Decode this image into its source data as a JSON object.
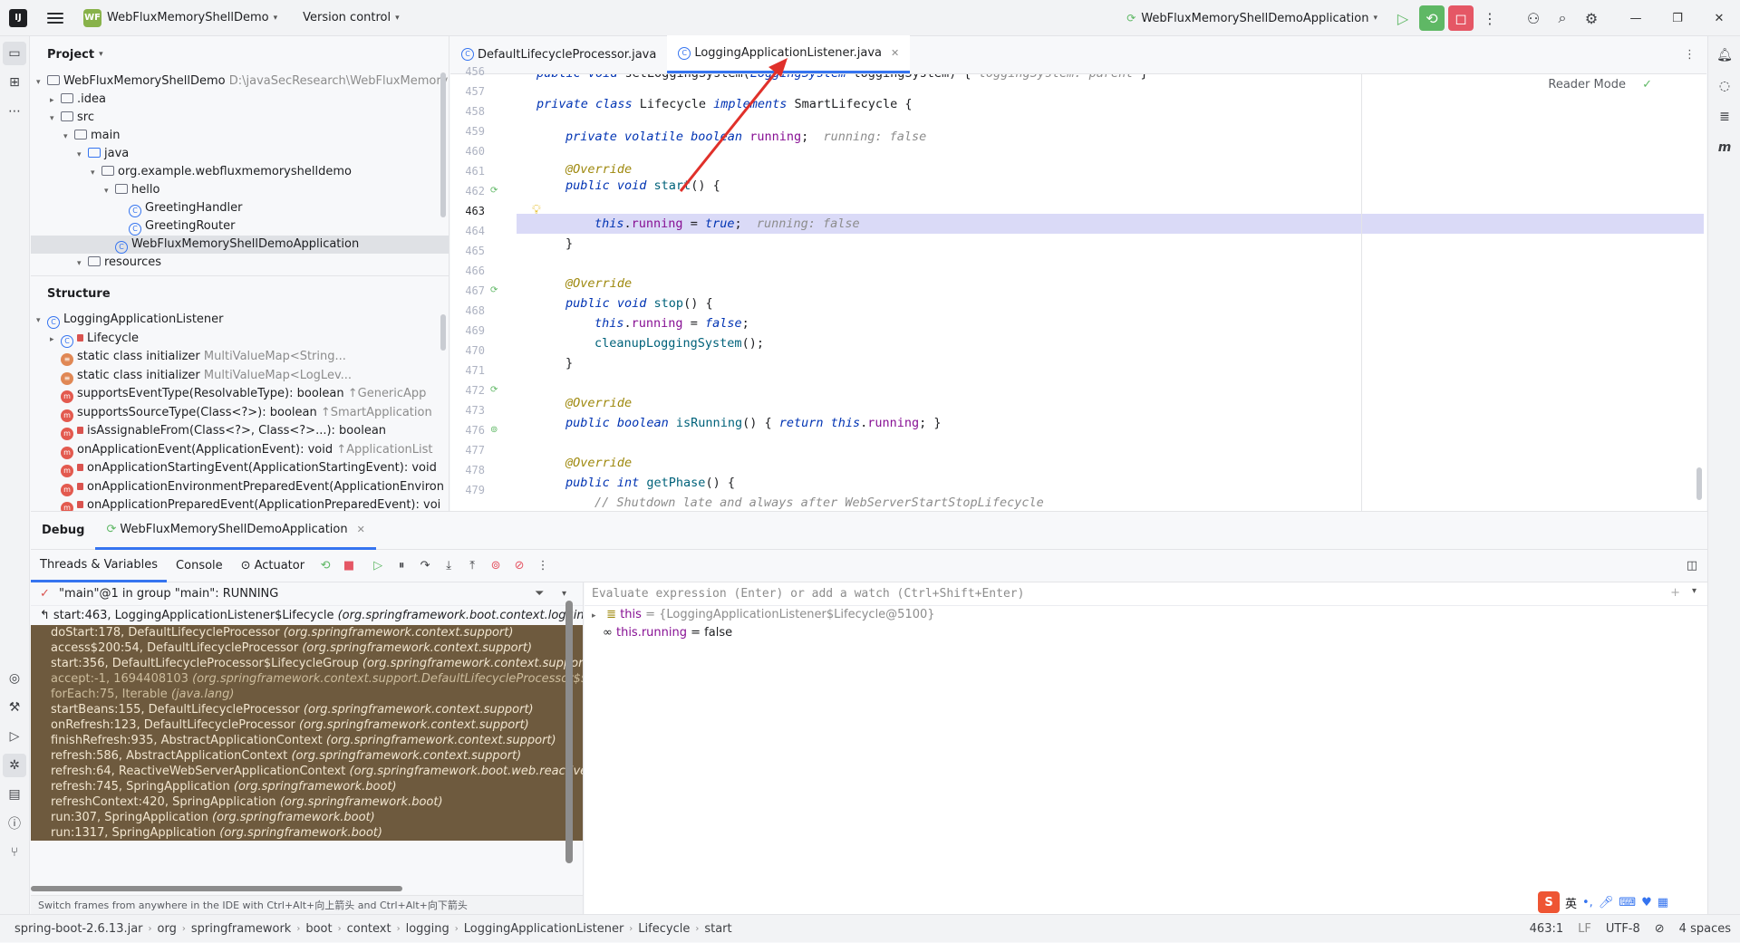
{
  "titlebar": {
    "project_badge": "WF",
    "project_name": "WebFluxMemoryShellDemo",
    "vcs_label": "Version control",
    "run_config": "WebFluxMemoryShellDemoApplication"
  },
  "project_panel": {
    "title": "Project",
    "tree": [
      {
        "indent": 0,
        "twisty": "▾",
        "icon": "folder",
        "label": "WebFluxMemoryShellDemo",
        "hint": "D:\\javaSecResearch\\WebFluxMemory"
      },
      {
        "indent": 1,
        "twisty": "▸",
        "icon": "folder",
        "label": ".idea",
        "hint": ""
      },
      {
        "indent": 1,
        "twisty": "▾",
        "icon": "folder",
        "label": "src",
        "hint": ""
      },
      {
        "indent": 2,
        "twisty": "▾",
        "icon": "folder",
        "label": "main",
        "hint": ""
      },
      {
        "indent": 3,
        "twisty": "▾",
        "icon": "folder-blue",
        "label": "java",
        "hint": ""
      },
      {
        "indent": 4,
        "twisty": "▾",
        "icon": "folder",
        "label": "org.example.webfluxmemoryshelldemo",
        "hint": ""
      },
      {
        "indent": 5,
        "twisty": "▾",
        "icon": "folder",
        "label": "hello",
        "hint": ""
      },
      {
        "indent": 6,
        "twisty": "",
        "icon": "class",
        "label": "GreetingHandler",
        "hint": ""
      },
      {
        "indent": 6,
        "twisty": "",
        "icon": "class",
        "label": "GreetingRouter",
        "hint": ""
      },
      {
        "indent": 5,
        "twisty": "",
        "icon": "class",
        "label": "WebFluxMemoryShellDemoApplication",
        "hint": "",
        "selected": true
      },
      {
        "indent": 3,
        "twisty": "▾",
        "icon": "folder",
        "label": "resources",
        "hint": ""
      }
    ]
  },
  "structure_panel": {
    "title": "Structure",
    "items": [
      {
        "indent": 0,
        "twisty": "▾",
        "icon": "class",
        "label": "LoggingApplicationListener",
        "hint": ""
      },
      {
        "indent": 1,
        "twisty": "▸",
        "icon": "class-lock",
        "label": "Lifecycle",
        "hint": ""
      },
      {
        "indent": 1,
        "twisty": "",
        "icon": "static",
        "label": "static class initializer",
        "hint": "MultiValueMap<String..."
      },
      {
        "indent": 1,
        "twisty": "",
        "icon": "static",
        "label": "static class initializer",
        "hint": "MultiValueMap<LogLev..."
      },
      {
        "indent": 1,
        "twisty": "",
        "icon": "method",
        "label": "supportsEventType(ResolvableType): boolean",
        "hint": "↑GenericApp"
      },
      {
        "indent": 1,
        "twisty": "",
        "icon": "method",
        "label": "supportsSourceType(Class<?>): boolean",
        "hint": "↑SmartApplication"
      },
      {
        "indent": 1,
        "twisty": "",
        "icon": "method-lock",
        "label": "isAssignableFrom(Class<?>, Class<?>...): boolean",
        "hint": ""
      },
      {
        "indent": 1,
        "twisty": "",
        "icon": "method",
        "label": "onApplicationEvent(ApplicationEvent): void",
        "hint": "↑ApplicationList"
      },
      {
        "indent": 1,
        "twisty": "",
        "icon": "method-lock",
        "label": "onApplicationStartingEvent(ApplicationStartingEvent): void",
        "hint": ""
      },
      {
        "indent": 1,
        "twisty": "",
        "icon": "method-lock",
        "label": "onApplicationEnvironmentPreparedEvent(ApplicationEnviron",
        "hint": ""
      },
      {
        "indent": 1,
        "twisty": "",
        "icon": "method-lock",
        "label": "onApplicationPreparedEvent(ApplicationPreparedEvent): voi",
        "hint": ""
      }
    ]
  },
  "editor": {
    "tabs": [
      {
        "label": "DefaultLifecycleProcessor.java",
        "active": false
      },
      {
        "label": "LoggingApplicationListener.java",
        "active": true
      }
    ],
    "reader_mode": "Reader Mode",
    "line_numbers": [
      "456",
      "457",
      "458",
      "459",
      "460",
      "461",
      "462",
      "463",
      "464",
      "465",
      "466",
      "467",
      "468",
      "469",
      "470",
      "471",
      "472",
      "473",
      "476",
      "477",
      "478",
      "479"
    ],
    "current_line": "463"
  },
  "debug": {
    "title": "Debug",
    "session": "WebFluxMemoryShellDemoApplication",
    "tabs": {
      "threads": "Threads & Variables",
      "console": "Console",
      "actuator": "Actuator"
    },
    "thread": "\"main\"@1 in group \"main\": RUNNING",
    "frames": [
      {
        "method": "start:463, LoggingApplicationListener$Lifecycle",
        "pkg": "(org.springframework.boot.context.logging",
        "current": true
      },
      {
        "method": "doStart:178, DefaultLifecycleProcessor",
        "pkg": "(org.springframework.context.support)"
      },
      {
        "method": "access$200:54, DefaultLifecycleProcessor",
        "pkg": "(org.springframework.context.support)"
      },
      {
        "method": "start:356, DefaultLifecycleProcessor$LifecycleGroup",
        "pkg": "(org.springframework.context.support"
      },
      {
        "method": "accept:-1, 1694408103",
        "pkg": "(org.springframework.context.support.DefaultLifecycleProcessor$$L",
        "lib": true
      },
      {
        "method": "forEach:75, Iterable",
        "pkg": "(java.lang)",
        "lib": true
      },
      {
        "method": "startBeans:155, DefaultLifecycleProcessor",
        "pkg": "(org.springframework.context.support)"
      },
      {
        "method": "onRefresh:123, DefaultLifecycleProcessor",
        "pkg": "(org.springframework.context.support)"
      },
      {
        "method": "finishRefresh:935, AbstractApplicationContext",
        "pkg": "(org.springframework.context.support)"
      },
      {
        "method": "refresh:586, AbstractApplicationContext",
        "pkg": "(org.springframework.context.support)"
      },
      {
        "method": "refresh:64, ReactiveWebServerApplicationContext",
        "pkg": "(org.springframework.boot.web.reactive."
      },
      {
        "method": "refresh:745, SpringApplication",
        "pkg": "(org.springframework.boot)"
      },
      {
        "method": "refreshContext:420, SpringApplication",
        "pkg": "(org.springframework.boot)"
      },
      {
        "method": "run:307, SpringApplication",
        "pkg": "(org.springframework.boot)"
      },
      {
        "method": "run:1317, SpringApplication",
        "pkg": "(org.springframework.boot)"
      }
    ],
    "eval_placeholder": "Evaluate expression (Enter) or add a watch (Ctrl+Shift+Enter)",
    "variables": [
      {
        "name": "this",
        "value": "= {LoggingApplicationListener$Lifecycle@5100}"
      },
      {
        "name": "this.running",
        "value": "= false"
      }
    ],
    "tip": "Switch frames from anywhere in the IDE with Ctrl+Alt+向上箭头 and Ctrl+Alt+向下箭头"
  },
  "statusbar": {
    "crumbs": [
      "spring-boot-2.6.13.jar",
      "org",
      "springframework",
      "boot",
      "context",
      "logging",
      "LoggingApplicationListener",
      "Lifecycle",
      "start"
    ],
    "position": "463:1",
    "line_sep": "LF",
    "encoding": "UTF-8",
    "indent": "4 spaces"
  },
  "ime": {
    "logo": "S",
    "lang": "英"
  }
}
